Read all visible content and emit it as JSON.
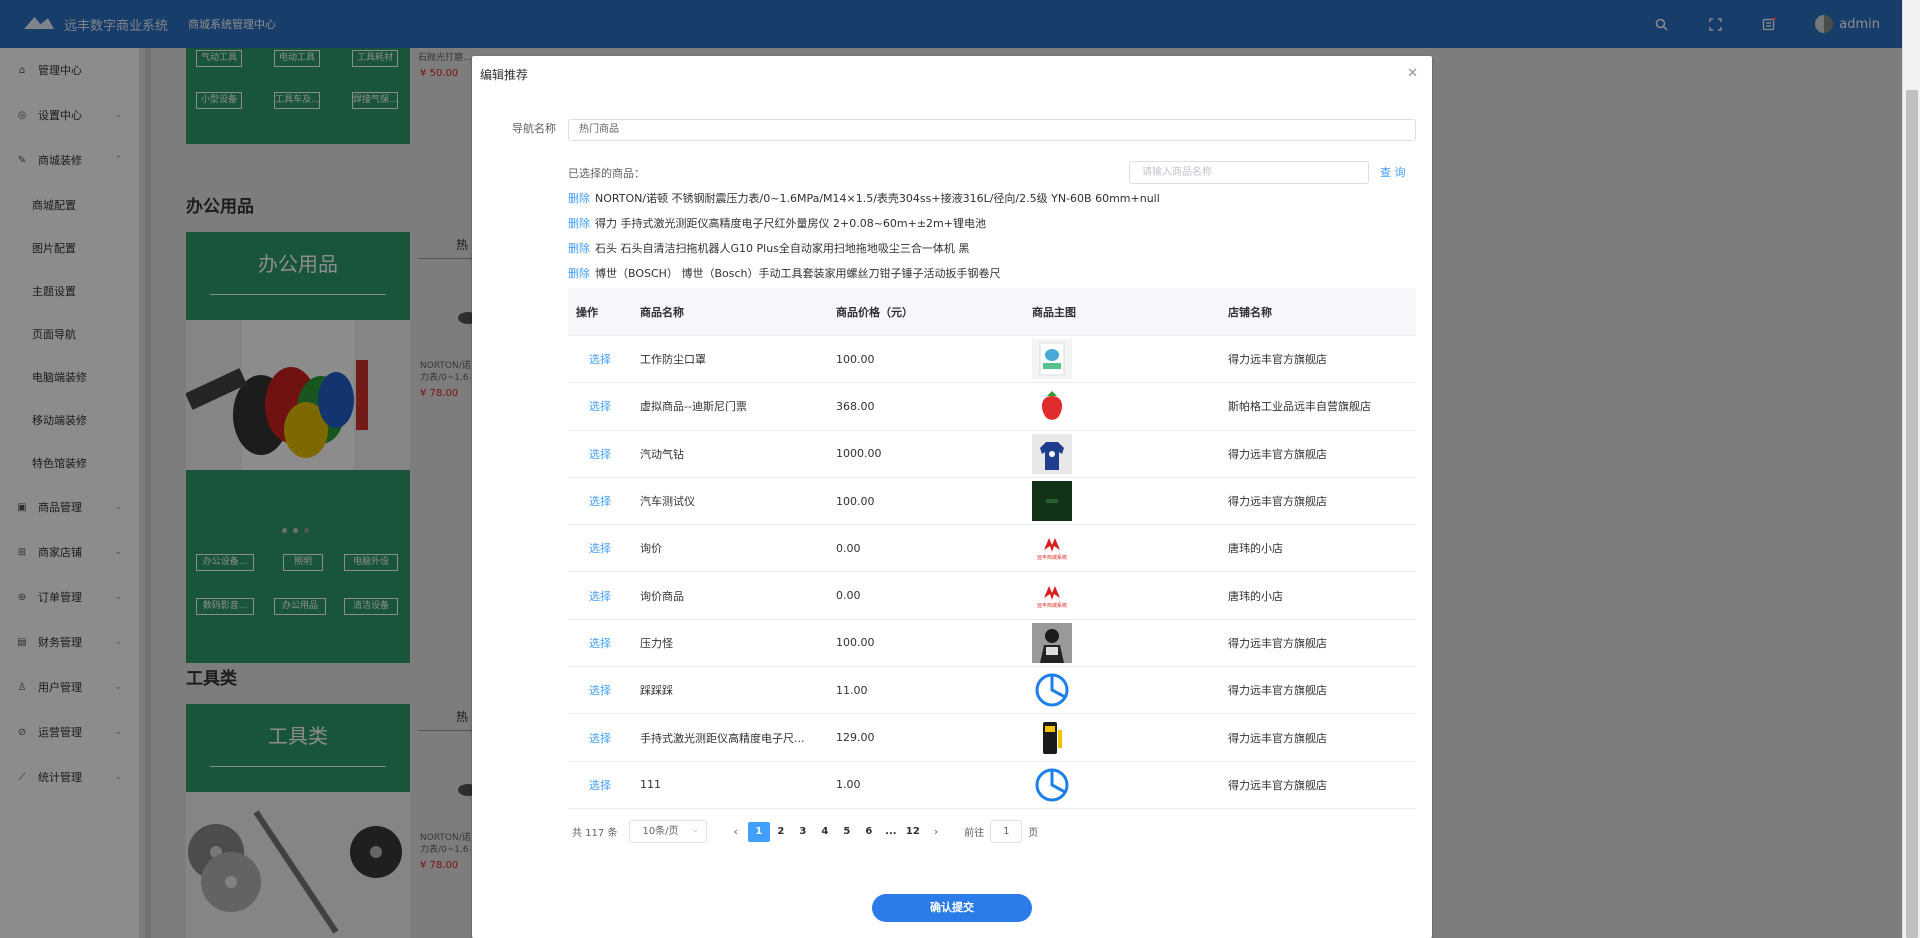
{
  "header": {
    "logo_text": "远丰数字商业系统",
    "system_title": "商城系统管理中心",
    "user_name": "admin"
  },
  "sidebar": {
    "items": [
      {
        "label": "管理中心",
        "icon": "home-icon",
        "arrow": false
      },
      {
        "label": "设置中心",
        "icon": "settings-circle-icon",
        "arrow": true
      },
      {
        "label": "商城装修",
        "icon": "paint-brush-icon",
        "arrow": true,
        "expanded": true
      },
      {
        "label": "商城配置",
        "sub": true
      },
      {
        "label": "图片配置",
        "sub": true
      },
      {
        "label": "主题设置",
        "sub": true
      },
      {
        "label": "页面导航",
        "sub": true
      },
      {
        "label": "电脑端装修",
        "sub": true
      },
      {
        "label": "移动端装修",
        "sub": true
      },
      {
        "label": "特色馆装修",
        "sub": true
      },
      {
        "label": "商品管理",
        "icon": "box-icon",
        "arrow": true
      },
      {
        "label": "商家店铺",
        "icon": "store-icon",
        "arrow": true
      },
      {
        "label": "订单管理",
        "icon": "order-icon",
        "arrow": true
      },
      {
        "label": "财务管理",
        "icon": "wallet-icon",
        "arrow": true
      },
      {
        "label": "用户管理",
        "icon": "user-icon",
        "arrow": true
      },
      {
        "label": "运营管理",
        "icon": "compass-icon",
        "arrow": true
      },
      {
        "label": "统计管理",
        "icon": "chart-line-icon",
        "arrow": true
      }
    ]
  },
  "background": {
    "top_tags_row1": [
      "气动工具",
      "电动工具",
      "工具耗材"
    ],
    "top_tags_row2": [
      "小型设备",
      "工具车及...",
      "焊接气保..."
    ],
    "top_product_text": "石抛光打磨...",
    "top_price": "¥ 50.00",
    "office_section_title": "办公用品",
    "office_panel_title": "办公用品",
    "hot_label": "热",
    "office_tags_row1": [
      "办公设备...",
      "照明",
      "电脑外设"
    ],
    "office_tags_row2": [
      "数码影音...",
      "办公用品",
      "清洁设备"
    ],
    "side_product_text_a": "NORTON/诺",
    "side_product_text_b": "力表/0~1.6",
    "side_price": "¥ 78.00",
    "tools_section_title": "工具类",
    "tools_panel_title": "工具类"
  },
  "dialog": {
    "title": "编辑推荐",
    "nav_name_label": "导航名称",
    "nav_name_value": "热门商品",
    "selected_label": "已选择的商品：",
    "search_placeholder": "请输入商品名称",
    "search_button": "查 询",
    "delete_label": "删除",
    "selected_products": [
      "NORTON/诺顿 不锈钢耐震压力表/0~1.6MPa/M14×1.5/表壳304ss+接液316L/径向/2.5级 YN-60B 60mm+null",
      "得力 手持式激光测距仪高精度电子尺红外量房仪 2+0.08~60m+±2m+锂电池",
      "石头 石头自清洁扫拖机器人G10 Plus全自动家用扫地拖地吸尘三合一体机 黑",
      "博世（BOSCH） 博世（Bosch）手动工具套装家用螺丝刀钳子锤子活动扳手钢卷尺"
    ],
    "table": {
      "headers": [
        "操作",
        "商品名称",
        "商品价格（元）",
        "商品主图",
        "店铺名称"
      ],
      "select_label": "选择",
      "rows": [
        {
          "name": "工作防尘口罩",
          "price": "100.00",
          "image": "mask-product",
          "shop": "得力远丰官方旗舰店"
        },
        {
          "name": "虚拟商品--迪斯尼门票",
          "price": "368.00",
          "image": "strawberry",
          "shop": "斯帕格工业品远丰自营旗舰店"
        },
        {
          "name": "汽动气钻",
          "price": "1000.00",
          "image": "sweater",
          "shop": "得力远丰官方旗舰店"
        },
        {
          "name": "汽车测试仪",
          "price": "100.00",
          "image": "dark-green",
          "shop": "得力远丰官方旗舰店"
        },
        {
          "name": "询价",
          "price": "0.00",
          "image": "yf-logo",
          "shop": "唐玮的小店"
        },
        {
          "name": "询价商品",
          "price": "0.00",
          "image": "yf-logo",
          "shop": "唐玮的小店"
        },
        {
          "name": "压力怪",
          "price": "100.00",
          "image": "person-photo",
          "shop": "得力远丰官方旗舰店"
        },
        {
          "name": "踩踩踩",
          "price": "11.00",
          "image": "pie-icon",
          "shop": "得力远丰官方旗舰店"
        },
        {
          "name": "手持式激光测距仪高精度电子尺...",
          "price": "129.00",
          "image": "laser-meter",
          "shop": "得力远丰官方旗舰店"
        },
        {
          "name": "111",
          "price": "1.00",
          "image": "pie-icon",
          "shop": "得力远丰官方旗舰店"
        }
      ],
      "image_logo_text": "远丰商城系统"
    },
    "pagination": {
      "total": "共 117 条",
      "page_size": "10条/页",
      "pages": [
        "1",
        "2",
        "3",
        "4",
        "5",
        "6",
        "...",
        "12"
      ],
      "current": "1",
      "goto_prefix": "前往",
      "goto_value": "1",
      "goto_suffix": "页"
    },
    "submit_label": "确认提交"
  },
  "colors": {
    "header_blue": "#2b6fc1",
    "panel_green": "#2e9b6b",
    "link_blue": "#409eff",
    "submit_blue": "#2b7ce9",
    "price_red": "#e02020"
  }
}
